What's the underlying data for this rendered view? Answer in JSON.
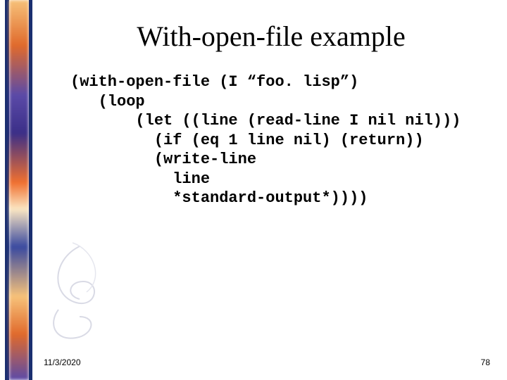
{
  "title": "With-open-file example",
  "code_lines": [
    "(with-open-file (I “foo. lisp”)",
    "   (loop",
    "       (let ((line (read-line I nil nil)))",
    "         (if (eq 1 line nil) (return))",
    "         (write-line",
    "           line",
    "           *standard-output*))))"
  ],
  "footer": {
    "date": "11/3/2020",
    "page": "78"
  }
}
